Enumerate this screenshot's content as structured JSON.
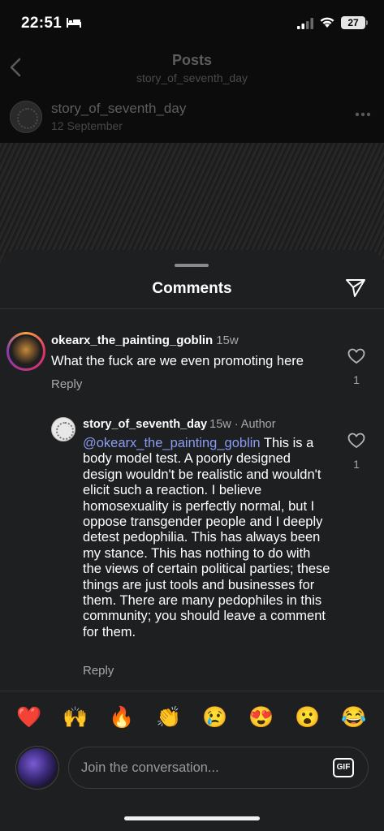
{
  "status_bar": {
    "time": "22:51",
    "battery": "27",
    "icons": [
      "bed-icon",
      "signal-icon",
      "wifi-icon",
      "battery-icon"
    ]
  },
  "background_page": {
    "title": "Posts",
    "subtitle": "story_of_seventh_day",
    "post_username": "story_of_seventh_day",
    "post_date": "12 September",
    "icons": [
      "back-arrow-icon",
      "more-options-icon"
    ]
  },
  "comments_sheet": {
    "title": "Comments",
    "accent_color": "#8a9cf2",
    "background_color": "#1e1f21",
    "comments": [
      {
        "username": "okearx_the_painting_goblin",
        "time": "15w",
        "text": "What the fuck are we even promoting here",
        "reply_label": "Reply",
        "likes": "1"
      }
    ],
    "replies": [
      {
        "username": "story_of_seventh_day",
        "meta": "15w · Author",
        "mention": "@okearx_the_painting_goblin",
        "text": " This is a body model test. A poorly designed design wouldn't be realistic and wouldn't elicit such a reaction. I believe homosexuality is perfectly normal, but I oppose transgender people and I deeply detest pedophilia. This has always been my stance. This has nothing to do with the views of certain political parties; these things are just tools and businesses for them. There are many pedophiles in this community; you should leave a comment for them.",
        "reply_label": "Reply",
        "likes": "1"
      }
    ],
    "emoji_reactions": [
      "❤️",
      "🙌",
      "🔥",
      "👏",
      "😢",
      "😍",
      "😮",
      "😂"
    ],
    "input": {
      "placeholder": "Join the conversation...",
      "gif_label": "GIF"
    }
  }
}
